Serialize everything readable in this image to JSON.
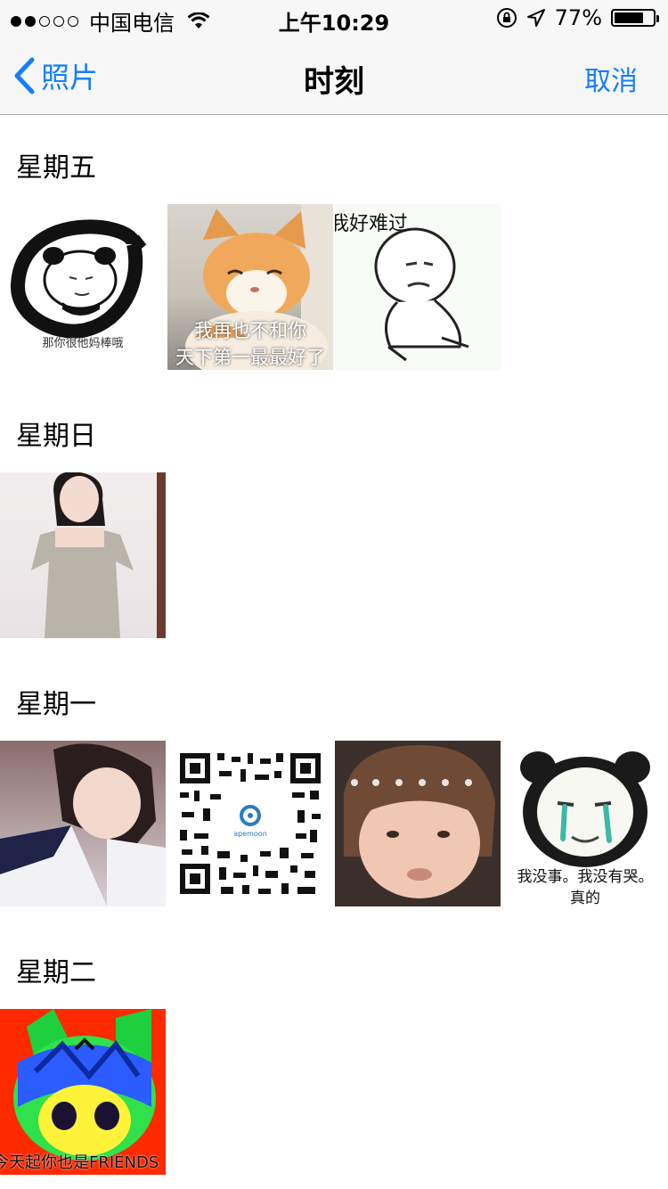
{
  "status_bar": {
    "carrier": "中国电信",
    "time": "上午10:29",
    "battery": "77%",
    "battery_level": 0.77
  },
  "nav": {
    "back_label": "照片",
    "title": "时刻",
    "cancel_label": "取消"
  },
  "sections": [
    {
      "title": "星期五",
      "photos": [
        {
          "caption": "那你很他妈棒哦"
        },
        {
          "caption_lines": [
            "我再也不和你",
            "天下第一最最好了"
          ]
        },
        {
          "caption": "我好难过"
        }
      ]
    },
    {
      "title": "星期日"
    },
    {
      "title": "星期一",
      "photos": [
        {},
        {
          "qr_logo_text": "apemoon"
        },
        {},
        {
          "caption_lines": [
            "我没事。我没有哭。",
            "真的"
          ]
        }
      ]
    },
    {
      "title": "星期二",
      "photos": [
        {
          "caption": "今天起你也是FRIENDS"
        }
      ]
    }
  ],
  "colors": {
    "accent": "#147efb",
    "bar_bg": "#f7f7f7"
  }
}
